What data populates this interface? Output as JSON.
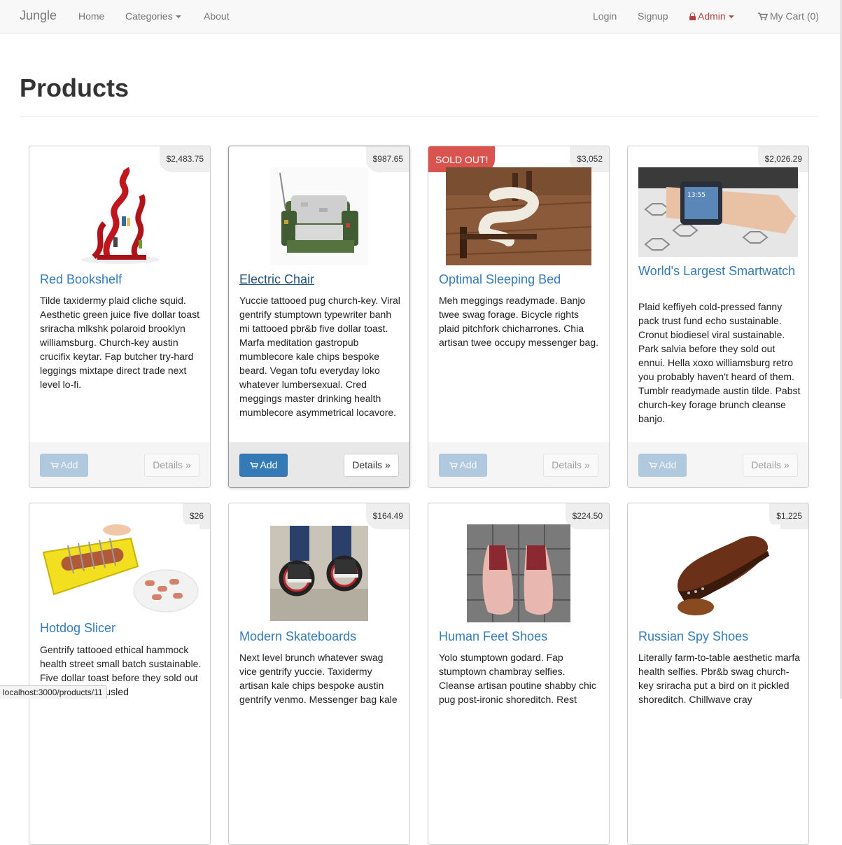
{
  "navbar": {
    "brand": "Jungle",
    "home": "Home",
    "categories": "Categories",
    "about": "About",
    "login": "Login",
    "signup": "Signup",
    "admin": "Admin",
    "cart": "My Cart (0)"
  },
  "page": {
    "title": "Products"
  },
  "buttons": {
    "add": "Add",
    "details": "Details »"
  },
  "products": [
    {
      "name": "Red Bookshelf",
      "price": "$2,483.75",
      "description": "Tilde taxidermy plaid cliche squid. Aesthetic green juice five dollar toast sriracha mlkshk polaroid brooklyn williamsburg. Church-key austin crucifix keytar. Fap butcher try-hard leggings mixtape direct trade next level lo-fi."
    },
    {
      "name": "Electric Chair",
      "price": "$987.65",
      "description": "Yuccie tattooed pug church-key. Viral gentrify stumptown typewriter banh mi tattooed pbr&b five dollar toast. Marfa meditation gastropub mumblecore kale chips bespoke beard. Vegan tofu everyday loko whatever lumbersexual. Cred meggings master drinking health mumblecore asymmetrical locavore."
    },
    {
      "name": "Optimal Sleeping Bed",
      "price": "$3,052",
      "badge": "SOLD OUT!",
      "description": "Meh meggings readymade. Banjo twee swag forage. Bicycle rights plaid pitchfork chicharrones. Chia artisan twee occupy messenger bag."
    },
    {
      "name": "World's Largest Smartwatch",
      "price": "$2,026.29",
      "description": "Plaid keffiyeh cold-pressed fanny pack trust fund echo sustainable. Cronut biodiesel viral sustainable. Park salvia before they sold out ennui. Hella xoxo williamsburg retro you probably haven't heard of them. Tumblr readymade austin tilde. Pabst church-key forage brunch cleanse banjo."
    },
    {
      "name": "Hotdog Slicer",
      "price": "$26",
      "description": "Gentrify tattooed ethical hammock health street small batch sustainable. Five dollar toast before they sold out gastropub yr tousled"
    },
    {
      "name": "Modern Skateboards",
      "price": "$164.49",
      "description": "Next level brunch whatever swag vice gentrify yuccie. Taxidermy artisan kale chips bespoke austin gentrify venmo. Messenger bag kale"
    },
    {
      "name": "Human Feet Shoes",
      "price": "$224.50",
      "description": "Yolo stumptown godard. Fap stumptown chambray selfies. Cleanse artisan poutine shabby chic pug post-ironic shoreditch. Rest"
    },
    {
      "name": "Russian Spy Shoes",
      "price": "$1,225",
      "description": "Literally farm-to-table aesthetic marfa health selfies. Pbr&b swag church-key sriracha put a bird on it pickled shoreditch. Chillwave cray"
    }
  ],
  "status_url": "localhost:3000/products/11"
}
